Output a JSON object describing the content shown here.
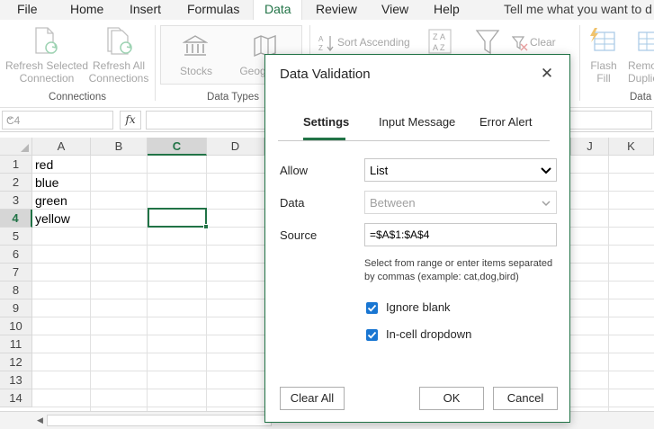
{
  "menu": {
    "tabs": [
      "File",
      "Home",
      "Insert",
      "Formulas",
      "Data",
      "Review",
      "View",
      "Help"
    ],
    "active_tab": "Data",
    "tell_me": "Tell me what you want to d"
  },
  "ribbon": {
    "refresh_selected": [
      "Refresh Selected",
      "Connection"
    ],
    "refresh_all": [
      "Refresh All",
      "Connections"
    ],
    "connections_group": "Connections",
    "stocks": "Stocks",
    "geography": "Geog",
    "data_types_group": "Data Types",
    "sort_ascending": "Sort Ascending",
    "clear": "Clear",
    "flash_fill": [
      "Flash",
      "Fill"
    ],
    "remove_duplicates": [
      "Remo",
      "Duplic"
    ],
    "data_tools_group": "Data"
  },
  "formula_bar": {
    "name_box": "C4",
    "fx": "fx",
    "formula": ""
  },
  "grid": {
    "columns": [
      "A",
      "B",
      "C",
      "D",
      "J",
      "K"
    ],
    "selected_column": "C",
    "rows": [
      "1",
      "2",
      "3",
      "4",
      "5",
      "6",
      "7",
      "8",
      "9",
      "10",
      "11",
      "12",
      "13",
      "14"
    ],
    "selected_row": "4",
    "cells_a": [
      "red",
      "blue",
      "green",
      "yellow"
    ]
  },
  "dialog": {
    "title": "Data Validation",
    "close": "✕",
    "tabs": [
      "Settings",
      "Input Message",
      "Error Alert"
    ],
    "active_tab": "Settings",
    "allow_label": "Allow",
    "allow_value": "List",
    "data_label": "Data",
    "data_value": "Between",
    "source_label": "Source",
    "source_value": "=$A$1:$A$4",
    "help_text": "Select from range or enter items separated by commas (example: cat,dog,bird)",
    "ignore_blank": "Ignore blank",
    "in_cell_dropdown": "In-cell dropdown",
    "ignore_blank_checked": true,
    "in_cell_dropdown_checked": true,
    "clear_all": "Clear All",
    "ok": "OK",
    "cancel": "Cancel"
  },
  "colors": {
    "accent": "#217346",
    "checkbox": "#1976d2"
  }
}
